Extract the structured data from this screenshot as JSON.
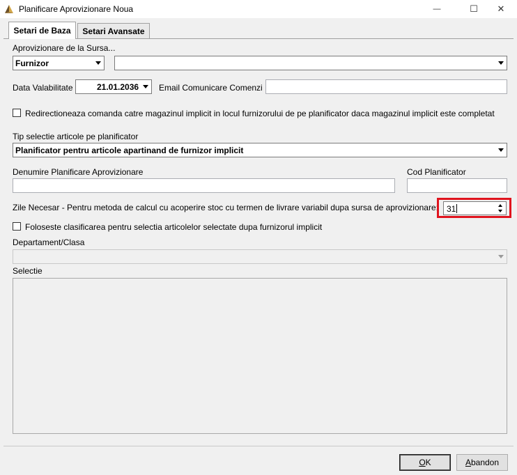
{
  "window": {
    "title": "Planificare Aprovizionare Noua",
    "minimize_glyph": "—",
    "maximize_glyph": "☐",
    "close_glyph": "✕"
  },
  "tabs": [
    {
      "label": "Setari de Baza",
      "active": true
    },
    {
      "label": "Setari Avansate",
      "active": false
    }
  ],
  "source": {
    "label": "Aprovizionare de la Sursa...",
    "type_value": "Furnizor",
    "supplier_value": ""
  },
  "validity": {
    "label": "Data Valabilitate",
    "date_value": "21.01.2036"
  },
  "email": {
    "label": "Email Comunicare Comenzi",
    "value": ""
  },
  "redirect_checkbox": {
    "label": "Redirectioneaza comanda catre magazinul implicit in locul furnizorului de pe planificator daca magazinul implicit este completat",
    "checked": false
  },
  "selection_type": {
    "label": "Tip selectie articole pe planificator",
    "value": "Planificator pentru articole apartinand de furnizor implicit"
  },
  "planner_name": {
    "label": "Denumire Planificare Aprovizionare",
    "value": ""
  },
  "planner_code": {
    "label": "Cod Planificator",
    "value": ""
  },
  "required_days": {
    "label": "Zile Necesar - Pentru metoda de calcul cu acoperire stoc cu termen de livrare variabil dupa sursa de aprovizionare:",
    "value": "31"
  },
  "classification_checkbox": {
    "label": "Foloseste clasificarea pentru selectia articolelor selectate dupa furnizorul implicit",
    "checked": false
  },
  "department": {
    "label": "Departament/Clasa",
    "value": ""
  },
  "selection": {
    "label": "Selectie"
  },
  "buttons": {
    "ok_hotkey": "O",
    "ok_rest": "K",
    "cancel_hotkey": "A",
    "cancel_rest": "bandon"
  },
  "colors": {
    "highlight": "#e0141e",
    "window_bg": "#f0f0f0"
  }
}
